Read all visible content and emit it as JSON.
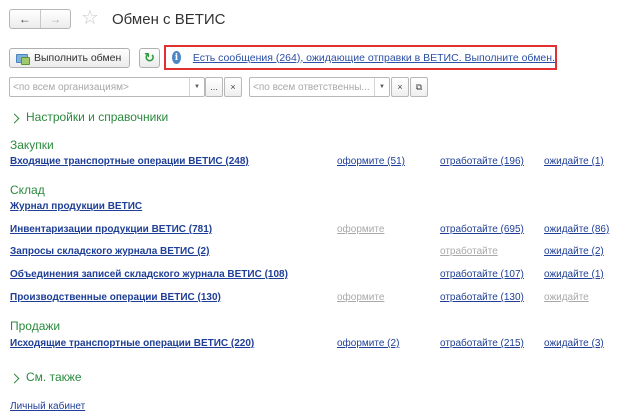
{
  "header": {
    "title": "Обмен с ВЕТИС",
    "back": "←",
    "forward": "→"
  },
  "toolbar": {
    "execute_label": "Выполнить обмен",
    "refresh_glyph": "↻",
    "message": "Есть сообщения (264), ожидающие отправки в ВЕТИС. Выполните обмен.",
    "info_glyph": "i"
  },
  "filters": {
    "organization_placeholder": "<по всем организациям>",
    "responsible_placeholder": "<по всем ответственны...",
    "more_glyph": "...",
    "clear_glyph": "×",
    "dropdown_glyph": "▼",
    "copy_glyph": "⧉"
  },
  "sections": {
    "settings": "Настройки и справочники",
    "see_also": "См. также"
  },
  "groups": {
    "purchases": {
      "title": "Закупки",
      "rows": [
        {
          "label": "Входящие транспортные операции ВЕТИС (248)",
          "col1": "оформите (51)",
          "col1_enabled": true,
          "col2": "отработайте (196)",
          "col2_enabled": true,
          "col3": "ожидайте (1)",
          "col3_enabled": true
        }
      ]
    },
    "warehouse": {
      "title": "Склад",
      "journal": "Журнал продукции ВЕТИС",
      "rows": [
        {
          "label": "Инвентаризации продукции ВЕТИС (781)",
          "col1": "оформите",
          "col1_enabled": false,
          "col2": "отработайте (695)",
          "col2_enabled": true,
          "col3": "ожидайте (86)",
          "col3_enabled": true
        },
        {
          "label": "Запросы складского журнала ВЕТИС (2)",
          "col1": "",
          "col1_enabled": false,
          "col2": "отработайте",
          "col2_enabled": false,
          "col3": "ожидайте (2)",
          "col3_enabled": true
        },
        {
          "label": "Объединения записей складского журнала ВЕТИС (108)",
          "col1": "",
          "col1_enabled": false,
          "col2": "отработайте (107)",
          "col2_enabled": true,
          "col3": "ожидайте (1)",
          "col3_enabled": true
        },
        {
          "label": "Производственные операции ВЕТИС (130)",
          "col1": "оформите",
          "col1_enabled": false,
          "col2": "отработайте (130)",
          "col2_enabled": true,
          "col3": "ожидайте",
          "col3_enabled": false
        }
      ]
    },
    "sales": {
      "title": "Продажи",
      "rows": [
        {
          "label": "Исходящие транспортные операции ВЕТИС (220)",
          "col1": "оформите (2)",
          "col1_enabled": true,
          "col2": "отработайте (215)",
          "col2_enabled": true,
          "col3": "ожидайте (3)",
          "col3_enabled": true
        }
      ]
    }
  },
  "footer": {
    "cabinet": "Личный кабинет"
  }
}
